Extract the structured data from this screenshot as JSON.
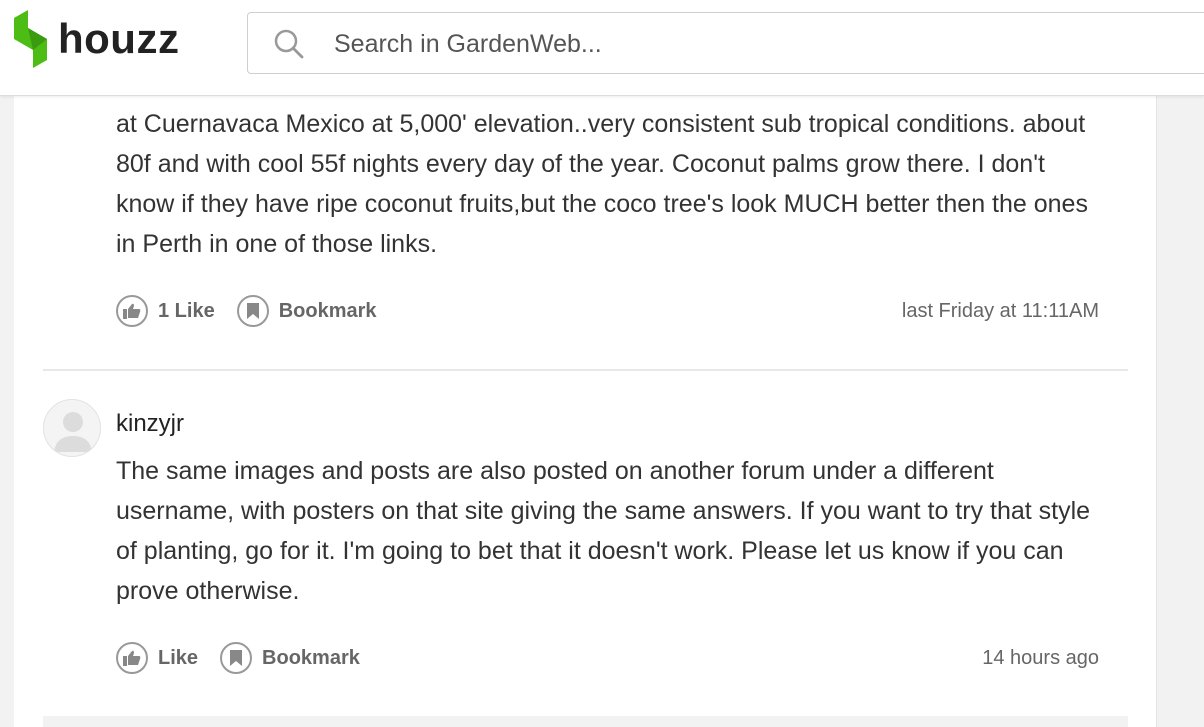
{
  "header": {
    "logo_text": "houzz",
    "brand_color": "#4dbc15",
    "search": {
      "placeholder": "Search in GardenWeb..."
    }
  },
  "posts": [
    {
      "text_partial_top": "",
      "body": "at Cuernavaca Mexico at 5,000' elevation..very consistent sub tropical conditions. about 80f and with cool 55f nights every day of the year. Coconut palms grow there. I don't know if they have ripe coconut fruits,but the coco tree's look MUCH better then the ones in Perth in one of those links.",
      "like_label": "1 Like",
      "bookmark_label": "Bookmark",
      "time": "last Friday at 11:11AM"
    },
    {
      "username": "kinzyjr",
      "body": "The same images and posts are also posted on another forum under a different username, with posters on that site giving the same answers. If you want to try that style of planting, go for it. I'm going to bet that it doesn't work. Please let us know if you can prove otherwise.",
      "like_label": "Like",
      "bookmark_label": "Bookmark",
      "time": "14 hours ago"
    }
  ],
  "icons": {
    "logo": "houzz-logo-icon",
    "search": "search-icon",
    "like": "thumbs-up-icon",
    "bookmark": "bookmark-icon",
    "avatar": "user-avatar-icon"
  }
}
